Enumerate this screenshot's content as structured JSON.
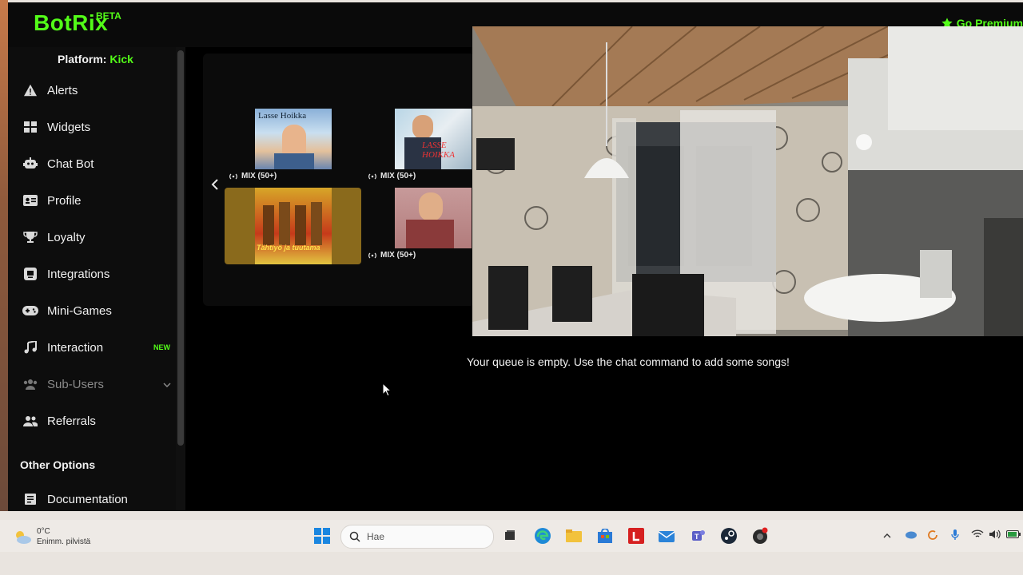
{
  "app": {
    "logo": "BotRix",
    "beta": "BETA",
    "premium": "Go Premium"
  },
  "sidebar": {
    "platform_label": "Platform:",
    "platform_value": "Kick",
    "items": [
      {
        "label": "Alerts",
        "icon": "warning-icon"
      },
      {
        "label": "Widgets",
        "icon": "grid-icon"
      },
      {
        "label": "Chat Bot",
        "icon": "robot-icon"
      },
      {
        "label": "Profile",
        "icon": "id-card-icon"
      },
      {
        "label": "Loyalty",
        "icon": "trophy-icon"
      },
      {
        "label": "Integrations",
        "icon": "integration-icon"
      },
      {
        "label": "Mini-Games",
        "icon": "gamepad-icon"
      },
      {
        "label": "Interaction",
        "icon": "music-icon",
        "badge": "NEW"
      },
      {
        "label": "Sub-Users",
        "icon": "users-icon"
      },
      {
        "label": "Referrals",
        "icon": "user-group-icon"
      }
    ],
    "other_options_title": "Other Options",
    "documentation": "Documentation"
  },
  "carousel": {
    "albums": [
      {
        "caption": "MIX (50+)",
        "art_text": "Lasse Hoikka"
      },
      {
        "caption": "MIX (50+)",
        "art_text": "LASSE HOIKKA"
      },
      {
        "caption": "",
        "art_text": "Tähtiyö ja tuutama"
      },
      {
        "caption": "MIX (50+)",
        "art_text": ""
      }
    ]
  },
  "queue": {
    "empty_message": "Your queue is empty. Use the chat command to add some songs!"
  },
  "taskbar": {
    "temperature": "0°C",
    "weather": "Enimm. pilvistä",
    "search_placeholder": "Hae"
  },
  "colors": {
    "accent": "#53fc18",
    "background": "#000000",
    "sidebar": "#0d0d0d",
    "taskbar": "#eeeae6"
  }
}
